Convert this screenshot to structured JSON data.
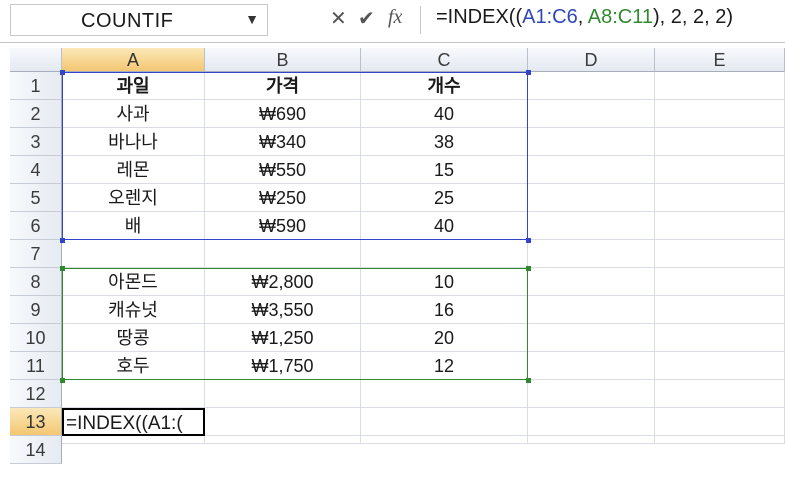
{
  "formula_bar": {
    "name_box": "COUNTIF",
    "cancel_glyph": "✕",
    "enter_glyph": "✔",
    "fx_glyph": "fx",
    "formula_parts": [
      "=INDEX((",
      "A1:C6",
      ", ",
      "A8:C11",
      "), 2, 2, 2)"
    ]
  },
  "columns": [
    "A",
    "B",
    "C",
    "D",
    "E"
  ],
  "rows": [
    "1",
    "2",
    "3",
    "4",
    "5",
    "6",
    "7",
    "8",
    "9",
    "10",
    "11",
    "12",
    "13",
    "14"
  ],
  "active": {
    "column": "A",
    "row": "13"
  },
  "table1": {
    "headers": [
      "과일",
      "가격",
      "개수"
    ],
    "rows": [
      [
        "사과",
        "₩690",
        "40"
      ],
      [
        "바나나",
        "₩340",
        "38"
      ],
      [
        "레몬",
        "₩550",
        "15"
      ],
      [
        "오렌지",
        "₩250",
        "25"
      ],
      [
        "배",
        "₩590",
        "40"
      ]
    ]
  },
  "table2": {
    "rows": [
      [
        "아몬드",
        "₩2,800",
        "10"
      ],
      [
        "캐슈넛",
        "₩3,550",
        "16"
      ],
      [
        "땅콩",
        "₩1,250",
        "20"
      ],
      [
        "호두",
        "₩1,750",
        "12"
      ]
    ]
  },
  "edit_cell": "=INDEX((A1:(",
  "colors": {
    "range1": "#3344cc",
    "range2": "#2f8a2f",
    "active_header": "#f4c772"
  }
}
